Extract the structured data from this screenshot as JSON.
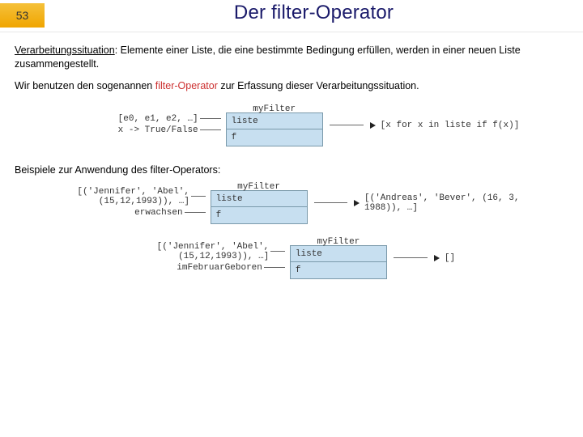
{
  "page_number": "53",
  "title": "Der filter-Operator",
  "para1_lead": "Verarbeitungssituation",
  "para1_rest": ": Elemente einer Liste, die eine bestimmte Bedingung erfüllen, werden in einer neuen Liste zusammengestellt.",
  "para2_pre": "Wir benutzen den sogenannen ",
  "para2_op": "filter-Operator",
  "para2_post": " zur Erfassung dieser Verarbeitungssituation.",
  "generic": {
    "box_title": "myFilter",
    "in_liste_label": "[e0, e1, e2, …]",
    "in_f_label": "x -> True/False",
    "port_liste": "liste",
    "port_f": "f",
    "out": "[x for x in liste if f(x)]"
  },
  "examples_heading": "Beispiele zur Anwendung des filter-Operators:",
  "ex1": {
    "box_title": "myFilter",
    "in_liste_label": "[('Jennifer', 'Abel', (15,12,1993)), …]",
    "in_f_label": "erwachsen",
    "port_liste": "liste",
    "port_f": "f",
    "out": "[('Andreas', 'Bever', (16, 3, 1988)), …]"
  },
  "ex2": {
    "box_title": "myFilter",
    "in_liste_label": "[('Jennifer', 'Abel', (15,12,1993)), …]",
    "in_f_label": "imFebruarGeboren",
    "port_liste": "liste",
    "port_f": "f",
    "out": "[]"
  }
}
